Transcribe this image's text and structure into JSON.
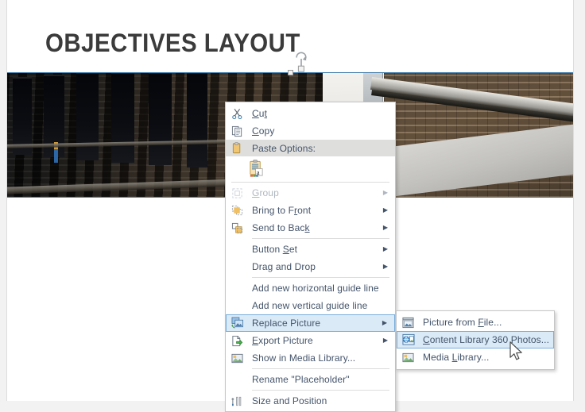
{
  "slide": {
    "title": "OBJECTIVES LAYOUT",
    "picture_placeholder_name": "Placeholder"
  },
  "context_menu": {
    "items": [
      {
        "id": "cut",
        "label": "Cut",
        "icon": "scissors-icon",
        "type": "item",
        "submenu": false,
        "disabled": false
      },
      {
        "id": "copy",
        "label": "Copy",
        "icon": "copy-icon",
        "type": "item",
        "submenu": false,
        "disabled": false
      },
      {
        "id": "paste-options",
        "label": "Paste Options:",
        "icon": "clipboard-icon",
        "type": "header",
        "submenu": false,
        "disabled": false
      },
      {
        "id": "paste-keep-text",
        "label": "",
        "icon": "paste-keep-text-icon",
        "type": "swatch",
        "submenu": false,
        "disabled": false
      },
      {
        "id": "sep-1",
        "label": "",
        "icon": "",
        "type": "separator"
      },
      {
        "id": "group",
        "label": "Group",
        "icon": "group-icon",
        "type": "item",
        "submenu": true,
        "disabled": true
      },
      {
        "id": "bring-to-front",
        "label": "Bring to Front",
        "icon": "bring-to-front-icon",
        "type": "item",
        "submenu": true,
        "disabled": false
      },
      {
        "id": "send-to-back",
        "label": "Send to Back",
        "icon": "send-to-back-icon",
        "type": "item",
        "submenu": true,
        "disabled": false
      },
      {
        "id": "sep-2",
        "label": "",
        "icon": "",
        "type": "separator"
      },
      {
        "id": "button-set",
        "label": "Button Set",
        "icon": "",
        "type": "item",
        "submenu": true,
        "disabled": false
      },
      {
        "id": "drag-and-drop",
        "label": "Drag and Drop",
        "icon": "",
        "type": "item",
        "submenu": true,
        "disabled": false
      },
      {
        "id": "sep-3",
        "label": "",
        "icon": "",
        "type": "separator"
      },
      {
        "id": "add-h-guide",
        "label": "Add new horizontal guide line",
        "icon": "",
        "type": "item",
        "submenu": false,
        "disabled": false
      },
      {
        "id": "add-v-guide",
        "label": "Add new vertical guide line",
        "icon": "",
        "type": "item",
        "submenu": false,
        "disabled": false
      },
      {
        "id": "replace-picture",
        "label": "Replace Picture",
        "icon": "replace-picture-icon",
        "type": "item",
        "submenu": true,
        "disabled": false,
        "highlighted": true
      },
      {
        "id": "export-picture",
        "label": "Export Picture",
        "icon": "export-picture-icon",
        "type": "item",
        "submenu": true,
        "disabled": false
      },
      {
        "id": "show-in-media-library",
        "label": "Show in Media Library...",
        "icon": "media-library-icon",
        "type": "item",
        "submenu": false,
        "disabled": false
      },
      {
        "id": "sep-4",
        "label": "",
        "icon": "",
        "type": "separator"
      },
      {
        "id": "rename-placeholder",
        "label": "Rename \"Placeholder\"",
        "icon": "",
        "type": "item",
        "submenu": false,
        "disabled": false
      },
      {
        "id": "sep-5",
        "label": "",
        "icon": "",
        "type": "separator"
      },
      {
        "id": "size-and-position",
        "label": "Size and Position",
        "icon": "size-position-icon",
        "type": "item",
        "submenu": false,
        "disabled": false
      }
    ]
  },
  "submenu": {
    "parent": "Replace Picture",
    "items": [
      {
        "id": "picture-from-file",
        "label": "Picture from File...",
        "icon": "picture-file-icon",
        "highlighted": false
      },
      {
        "id": "content-library-360",
        "label": "Content Library 360 Photos...",
        "icon": "content-library-icon",
        "highlighted": true
      },
      {
        "id": "media-library",
        "label": "Media Library...",
        "icon": "media-library-icon",
        "highlighted": false
      }
    ]
  },
  "colors": {
    "menu_text": "#44546a",
    "menu_disabled_text": "#b0b7c1",
    "highlight_bg": "#dbeaf7",
    "highlight_border": "#7aaedb",
    "header_bg": "#dededc",
    "selection_outline": "#3f7cac",
    "title_text": "#3b3b3b",
    "canvas_bg": "#ffffff",
    "app_bg": "#f2f2f2"
  }
}
